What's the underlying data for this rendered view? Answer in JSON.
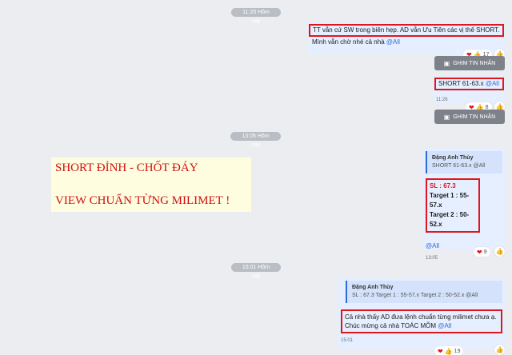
{
  "chat": {
    "time_dividers": [
      "11:20 Hôm nay",
      "13:05 Hôm nay",
      "15:01 Hôm nay"
    ],
    "msg1": {
      "line1": "TT vẫn cứ SW trong biên hẹp. AD vẫn Ưu Tiên các vị thế SHORT.",
      "line2": "Mình vẫn chờ nhé cả nhà ",
      "mention": "@All",
      "heart_count": "17",
      "pin_label": "GHIM TIN NHẮN"
    },
    "msg2": {
      "text": "SHORT 61-63.x ",
      "mention": "@All",
      "time": "11:26",
      "heart_count": "8",
      "pin_label": "GHIM TIN NHẮN"
    },
    "promo": {
      "line1": "SHORT ĐỈNH - CHỐT ĐÁY",
      "line2": "VIEW CHUẨN TỪNG MILIMET !"
    },
    "msg3": {
      "quote_name": "Đặng Anh Thùy",
      "quote_text": "SHORT 61-63.x @All",
      "sl": "SL : 67.3",
      "target1": "Target 1 : 55-57.x",
      "target2": "Target 2 : 50-52.x",
      "mention": "@All",
      "time": "13:05",
      "heart_count": "9"
    },
    "msg4": {
      "quote_name": "Đặng Anh Thùy",
      "quote_text": "SL : 67.3 Target 1 : 55-57.x Target 2 : 50-52.x @All",
      "line1": "Cả nhà thấy AD đưa lệnh chuẩn từng milimet chưa ạ.",
      "line2": "Chúc mừng cả nhà TOÁC MÕM ",
      "mention": "@All",
      "time": "15:01",
      "heart_count": "19"
    }
  },
  "icons": {
    "heart": "heart-icon",
    "thumb": "thumbs-up-icon",
    "like": "like-icon",
    "pin": "pin-icon"
  },
  "colors": {
    "red_highlight": "#e0161b",
    "bubble_bg": "#e5efff",
    "mention_blue": "#2c6bd6",
    "promo_bg": "#fffde0",
    "promo_text": "#d10f0f"
  }
}
